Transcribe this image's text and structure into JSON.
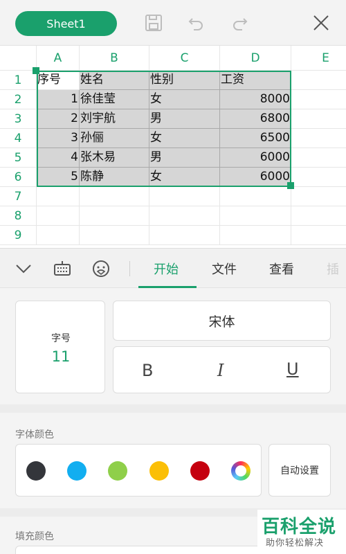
{
  "topbar": {
    "sheet_label": "Sheet1",
    "icons": [
      "save-icon",
      "undo-icon",
      "redo-icon",
      "close-icon"
    ]
  },
  "sheet": {
    "columns": [
      "A",
      "B",
      "C",
      "D",
      "E"
    ],
    "rows": [
      "1",
      "2",
      "3",
      "4",
      "5",
      "6",
      "7",
      "8",
      "9"
    ],
    "header_row": [
      "序号",
      "姓名",
      "性别",
      "工资"
    ],
    "data_rows": [
      [
        "1",
        "徐佳莹",
        "女",
        "8000"
      ],
      [
        "2",
        "刘宇航",
        "男",
        "6800"
      ],
      [
        "3",
        "孙俪",
        "女",
        "6500"
      ],
      [
        "4",
        "张木易",
        "男",
        "6000"
      ],
      [
        "5",
        "陈静",
        "女",
        "6000"
      ]
    ]
  },
  "toolbar": {
    "icons": [
      "collapse-chevron-icon",
      "keyboard-icon",
      "emoji-icon"
    ],
    "tabs": [
      {
        "label": "开始",
        "active": true
      },
      {
        "label": "文件",
        "active": false
      },
      {
        "label": "查看",
        "active": false
      },
      {
        "label": "插",
        "active": false
      }
    ]
  },
  "panel": {
    "font_size_label": "字号",
    "font_size_value": "11",
    "font_name": "宋体",
    "bold_label": "B",
    "italic_label": "I",
    "underline_label": "U",
    "font_color_title": "字体颜色",
    "colors": [
      "#34363b",
      "#12aef0",
      "#8fcf4a",
      "#fbbf07",
      "#c5000f"
    ],
    "auto_label": "自动设置",
    "fill_color_title": "填充颜色"
  },
  "watermark": {
    "title": "百科全说",
    "subtitle": "助你轻松解决"
  }
}
